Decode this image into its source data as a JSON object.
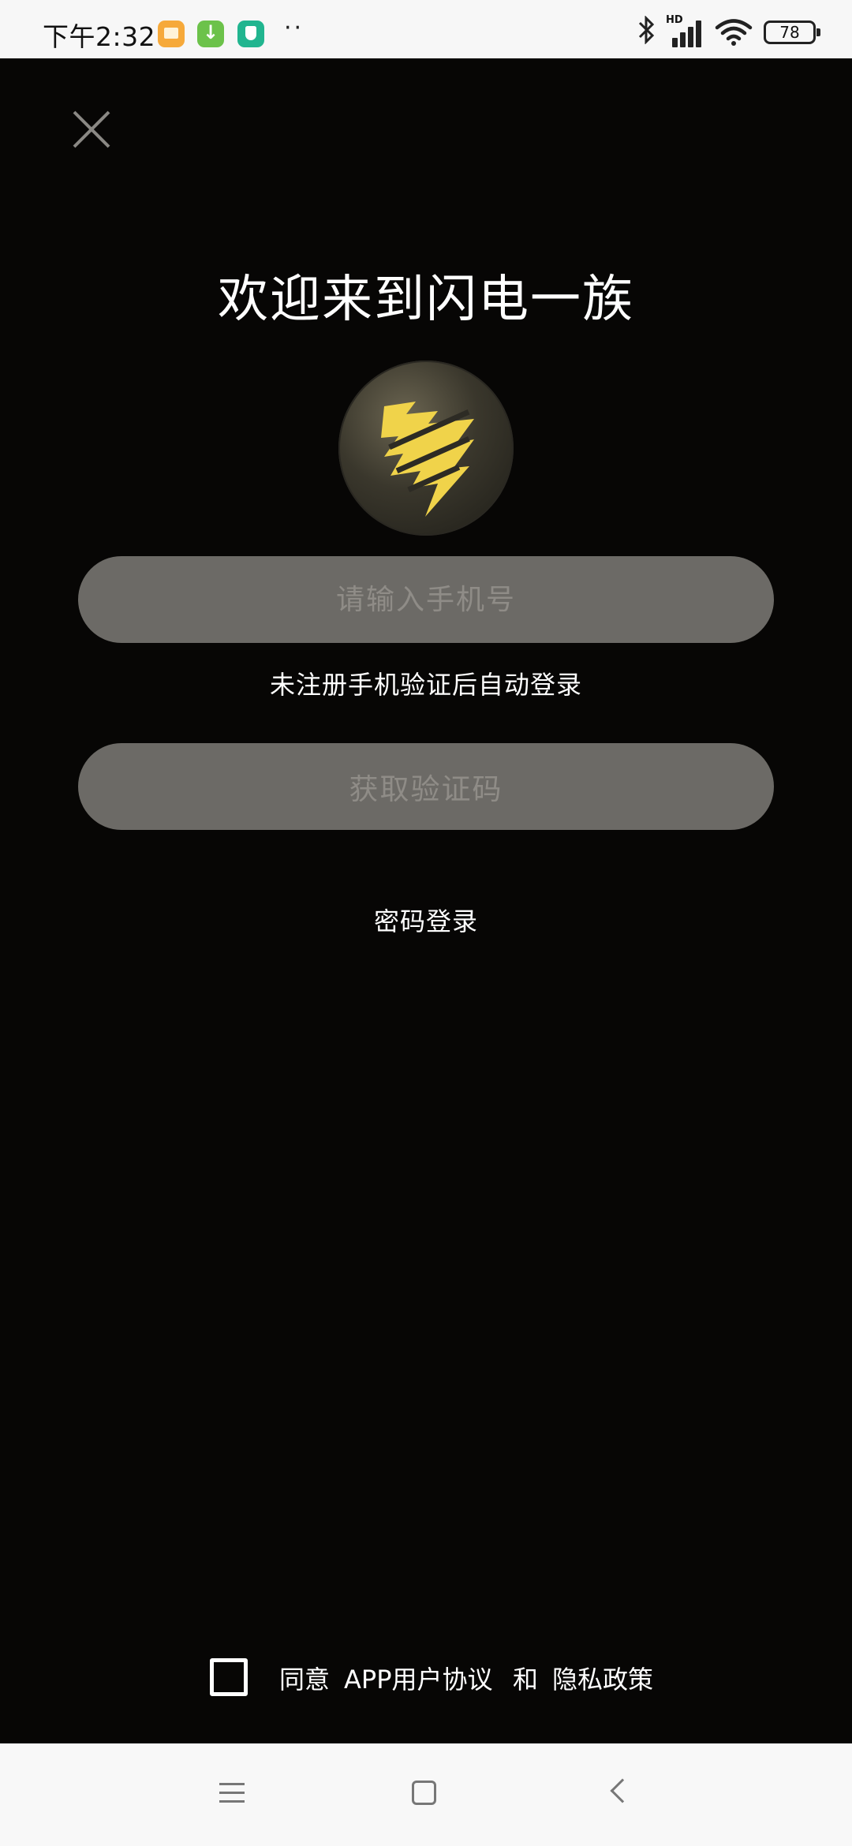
{
  "status_bar": {
    "time": "下午2:32",
    "more": "··",
    "network_label": "HD",
    "battery_level": "78",
    "icons": [
      "message-app-icon",
      "download-app-icon",
      "security-app-icon",
      "bluetooth-icon",
      "signal-icon",
      "wifi-icon",
      "battery-icon"
    ]
  },
  "login": {
    "title": "欢迎来到闪电一族",
    "phone_placeholder": "请输入手机号",
    "phone_value": "",
    "hint": "未注册手机验证后自动登录",
    "get_code_label": "获取验证码",
    "password_login_label": "密码登录"
  },
  "agreement": {
    "checked": false,
    "agree_text": "同意",
    "user_agreement_link": "APP用户协议",
    "and_text": "和",
    "privacy_policy_link": "隐私政策"
  },
  "colors": {
    "background": "#070605",
    "input_fill": "#6c6a66",
    "logo_yellow": "#f0d34a",
    "text": "#ffffff"
  },
  "nav_bar": {
    "icons": [
      "menu-icon",
      "home-icon",
      "back-icon"
    ]
  }
}
